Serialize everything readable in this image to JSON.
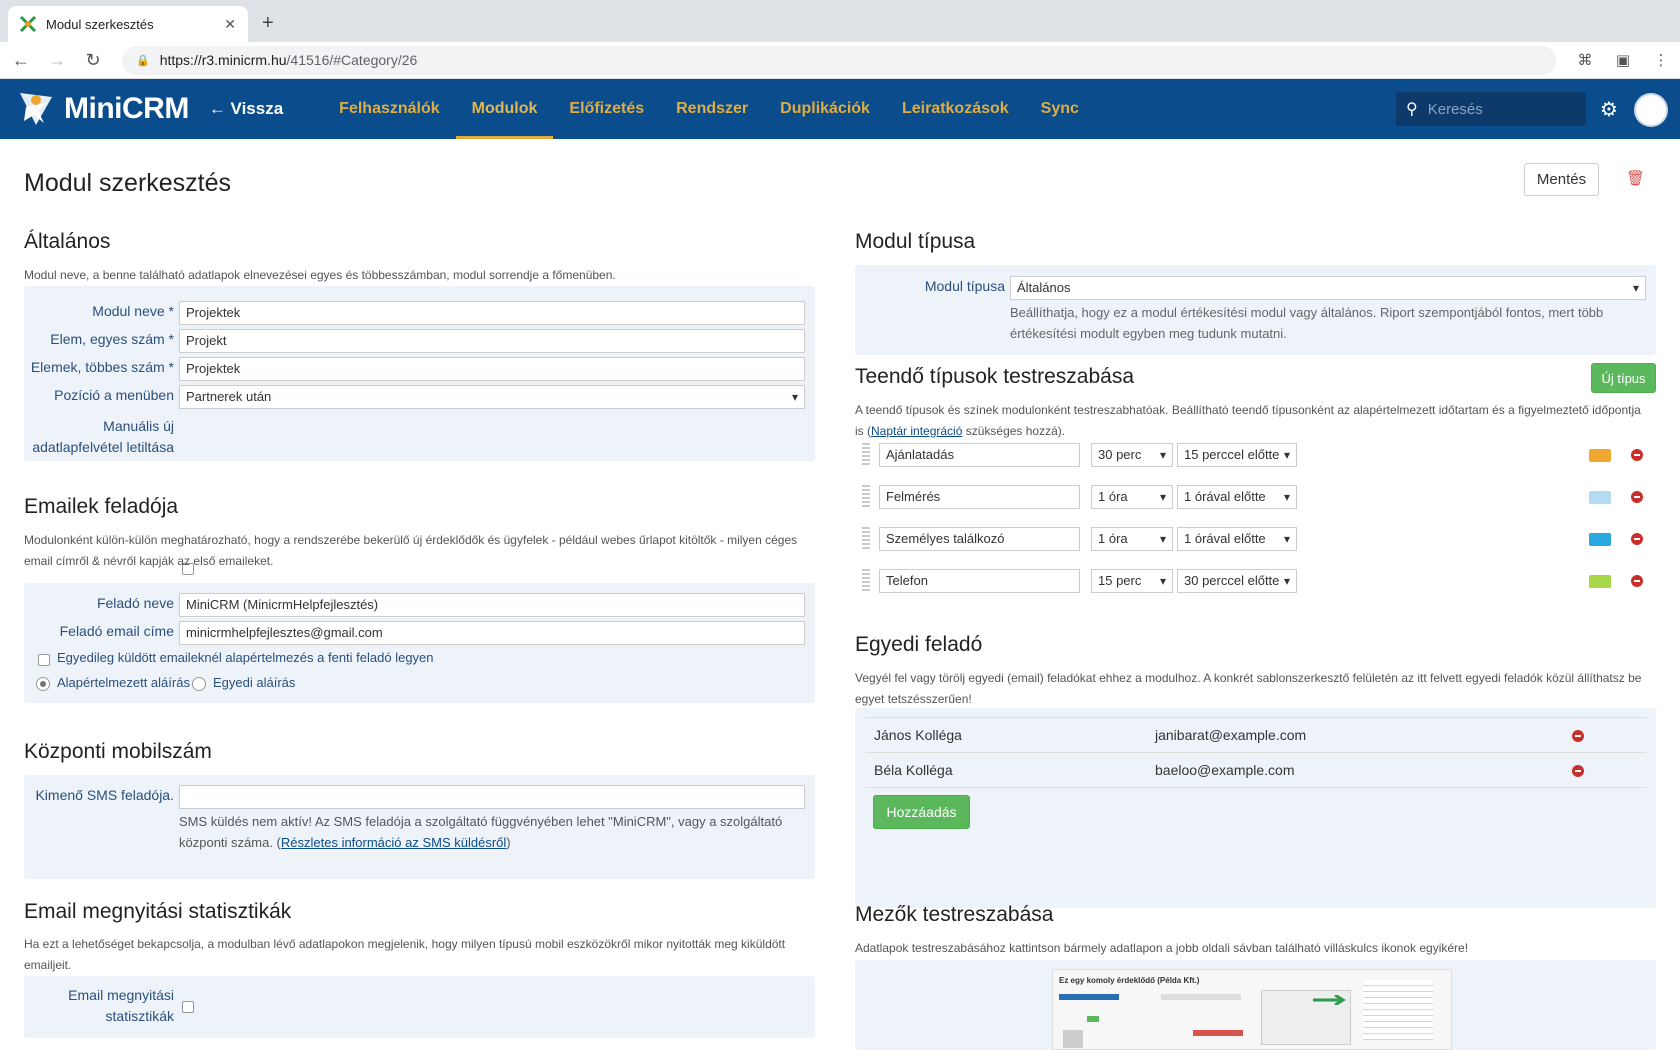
{
  "browser": {
    "tab_title": "Modul szerkesztés",
    "url_host": "https://r3.minicrm.hu",
    "url_path": "/41516/#Category/26"
  },
  "header": {
    "brand": "MiniCRM",
    "back_label": "Vissza",
    "nav": [
      "Felhasználók",
      "Modulok",
      "Előfizetés",
      "Rendszer",
      "Duplikációk",
      "Leiratkozások",
      "Sync"
    ],
    "active_nav": "Modulok",
    "search_placeholder": "Keresés"
  },
  "page": {
    "title": "Modul szerkesztés",
    "save_label": "Mentés"
  },
  "general": {
    "title": "Általános",
    "desc": "Modul neve, a benne található adatlapok elnevezései egyes és többesszámban, modul sorrendje a főmenüben.",
    "name_label": "Modul neve *",
    "name_value": "Projektek",
    "singular_label": "Elem, egyes szám *",
    "singular_value": "Projekt",
    "plural_label": "Elemek, többes szám *",
    "plural_value": "Projektek",
    "position_label": "Pozíció a menüben",
    "position_value": "Partnerek után",
    "manual_label_1": "Manuális új",
    "manual_label_2": "adatlapfelvétel letiltása"
  },
  "email_sender": {
    "title": "Emailek feladója",
    "desc_1": "Modulonként külön-külön meghatározható, hogy a rendszerébe bekerülő új érdeklődők és ügyfelek - például webes űrlapot kitöltők - milyen céges",
    "desc_2": "email címről & névről kapják az első emaileket.",
    "name_label": "Feladó neve",
    "name_value": "MiniCRM (MinicrmHelpfejlesztés)",
    "email_label": "Feladó email címe",
    "email_value": "minicrmhelpfejlesztes@gmail.com",
    "individual_label": "Egyedileg küldött emaileknél alapértelmezés a fenti feladó legyen",
    "sig_default": "Alapértelmezett aláírás",
    "sig_custom": "Egyedi aláírás"
  },
  "sms": {
    "title": "Központi mobilszám",
    "label": "Kimenő SMS feladója.",
    "note_1": "SMS küldés nem aktív!  Az SMS feladója a szolgáltató függvényében lehet \"MiniCRM\", vagy a szolgáltató",
    "note_2a": "központi száma. (",
    "note_link": "Részletes információ az SMS küldésről",
    "note_2b": ")"
  },
  "stats": {
    "title": "Email megnyitási statisztikák",
    "desc_1": "Ha ezt a lehetőséget bekapcsolja, a modulban lévő adatlapokon megjelenik, hogy milyen típusú mobil eszközökről mikor nyitották meg kiküldött",
    "desc_2": "emailjeit.",
    "label_1": "Email megnyitási",
    "label_2": "statisztikák"
  },
  "module_type": {
    "title": "Modul típusa",
    "label": "Modul típusa",
    "value": "Általános",
    "help_1": "Beállíthatja, hogy ez a modul értékesítési modul vagy általános. Riport szempontjából fontos, mert több",
    "help_2": "értékesítési modult egyben meg tudunk mutatni."
  },
  "todo_types": {
    "title": "Teendő típusok testreszabása",
    "new_label": "Új típus",
    "desc_1": "A teendő típusok és színek modulonként testreszabhatóak. Beállítható teendő típusonként az alapértelmezett időtartam és a figyelmeztető időpontja",
    "desc_2a": "is (",
    "desc_link": "Naptár integráció",
    "desc_2b": " szükséges hozzá).",
    "items": [
      {
        "name": "Ajánlatadás",
        "duration": "30 perc",
        "reminder": "15 perccel előtte",
        "color": "#f0a830"
      },
      {
        "name": "Felmérés",
        "duration": "1 óra",
        "reminder": "1 órával előtte",
        "color": "#b4dcf0"
      },
      {
        "name": "Személyes találkozó",
        "duration": "1 óra",
        "reminder": "1 órával előtte",
        "color": "#2aa8e0"
      },
      {
        "name": "Telefon",
        "duration": "15 perc",
        "reminder": "30 perccel előtte",
        "color": "#a8d84a"
      }
    ]
  },
  "custom_sender": {
    "title": "Egyedi feladó",
    "desc_1": "Vegyél fel vagy törölj egyedi (email) feladókat ehhez a modulhoz. A konkrét sablonszerkesztő felületén az itt felvett egyedi feladók közül állíthatsz be",
    "desc_2": "egyet tetszésszerűen!",
    "rows": [
      {
        "name": "János Kolléga",
        "email": "janibarat@example.com"
      },
      {
        "name": "Béla Kolléga",
        "email": "baeloo@example.com"
      }
    ],
    "add_label": "Hozzáadás"
  },
  "fields": {
    "title": "Mezők testreszabása",
    "desc": "Adatlapok testreszabásához kattintson bármely adatlapon a jobb oldali sávban található villáskulcs ikonok egyikére!",
    "preview_title": "Ez egy komoly érdeklődő (Példa Kft.)"
  }
}
